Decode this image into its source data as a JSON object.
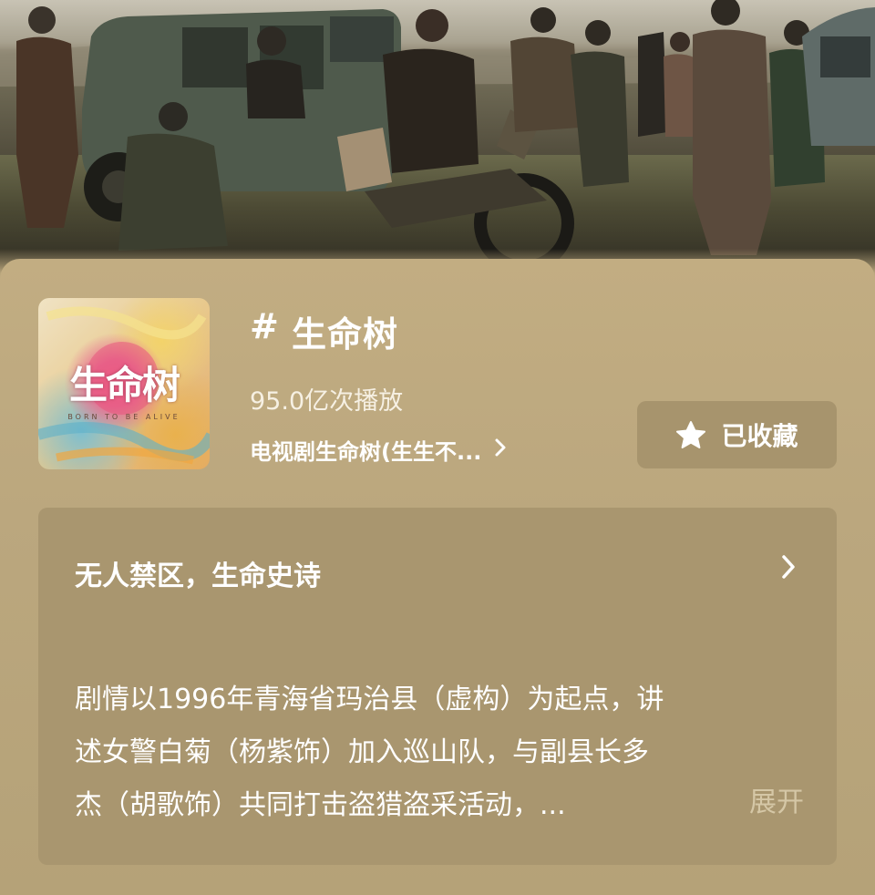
{
  "hero": {
    "image": "drama-cast-poster"
  },
  "topic": {
    "hash": "#",
    "title": "生命树",
    "plays": "95.0亿次播放",
    "source_link": "电视剧生命树(生生不...",
    "source_chevron": "chevron-right-icon",
    "cover_title": "生命树",
    "cover_subtitle": "BORN  TO  BE  ALIVE"
  },
  "favorite": {
    "label": "已收藏",
    "icon": "star-icon"
  },
  "description": {
    "heading": "无人禁区，生命史诗",
    "lines": [
      "剧情以1996年青海省玛治县（虚构）为起点，讲",
      "述女警白菊（杨紫饰）加入巡山队，与副县长多",
      "杰（胡歌饰）共同打击盗猎盗采活动，..."
    ],
    "expand": "展开"
  },
  "colors": {
    "panel": "#bba77e",
    "card": "#a9966f",
    "button": "#a7946d"
  }
}
